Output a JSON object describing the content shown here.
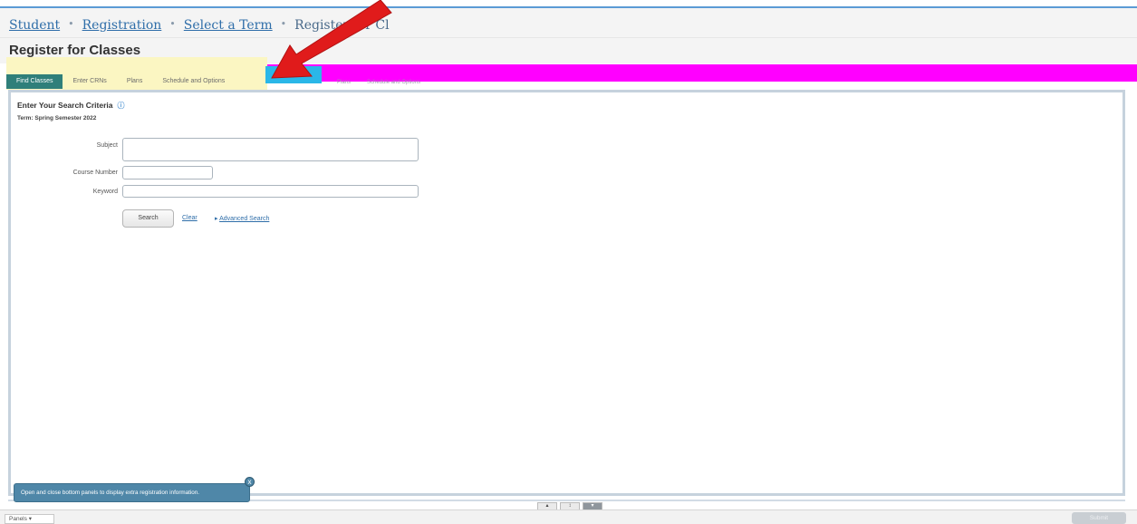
{
  "breadcrumb": {
    "items": [
      "Student",
      "Registration",
      "Select a Term"
    ],
    "separator": "•",
    "current": "Register for Cl"
  },
  "page": {
    "title": "Register for Classes"
  },
  "tabs": [
    {
      "label": "Find Classes",
      "active": true
    },
    {
      "label": "Enter CRNs",
      "active": false
    },
    {
      "label": "Plans",
      "active": false
    },
    {
      "label": "Schedule and Options",
      "active": false
    }
  ],
  "ghost_tabs": [
    "Plans",
    "Schedule and Options"
  ],
  "search": {
    "title": "Enter Your Search Criteria",
    "info_icon": "info-icon",
    "term": "Term: Spring Semester 2022",
    "fields": {
      "subject_label": "Subject",
      "subject_value": "",
      "course_number_label": "Course Number",
      "course_number_value": "",
      "keyword_label": "Keyword",
      "keyword_value": ""
    },
    "search_button": "Search",
    "clear_link": "Clear",
    "advanced_link": "Advanced Search",
    "advanced_arrow": "▸"
  },
  "tooltip": {
    "text": "Open and close bottom panels to display extra registration information.",
    "close_glyph": "x"
  },
  "bottom": {
    "panels_label": "Panels",
    "panels_caret": "▾",
    "splitter": [
      "▴",
      "↕",
      "▾"
    ],
    "submit_label": "Submit"
  },
  "colors": {
    "link": "#2f6ea9",
    "active_tab": "#2f7f7a",
    "highlight_yellow": "#fbf6c2",
    "annotation_magenta": "#ff00ff",
    "annotation_cyan": "#2ab7e8",
    "arrow_red": "#e01b1b",
    "tooltip": "#4f87a8"
  }
}
